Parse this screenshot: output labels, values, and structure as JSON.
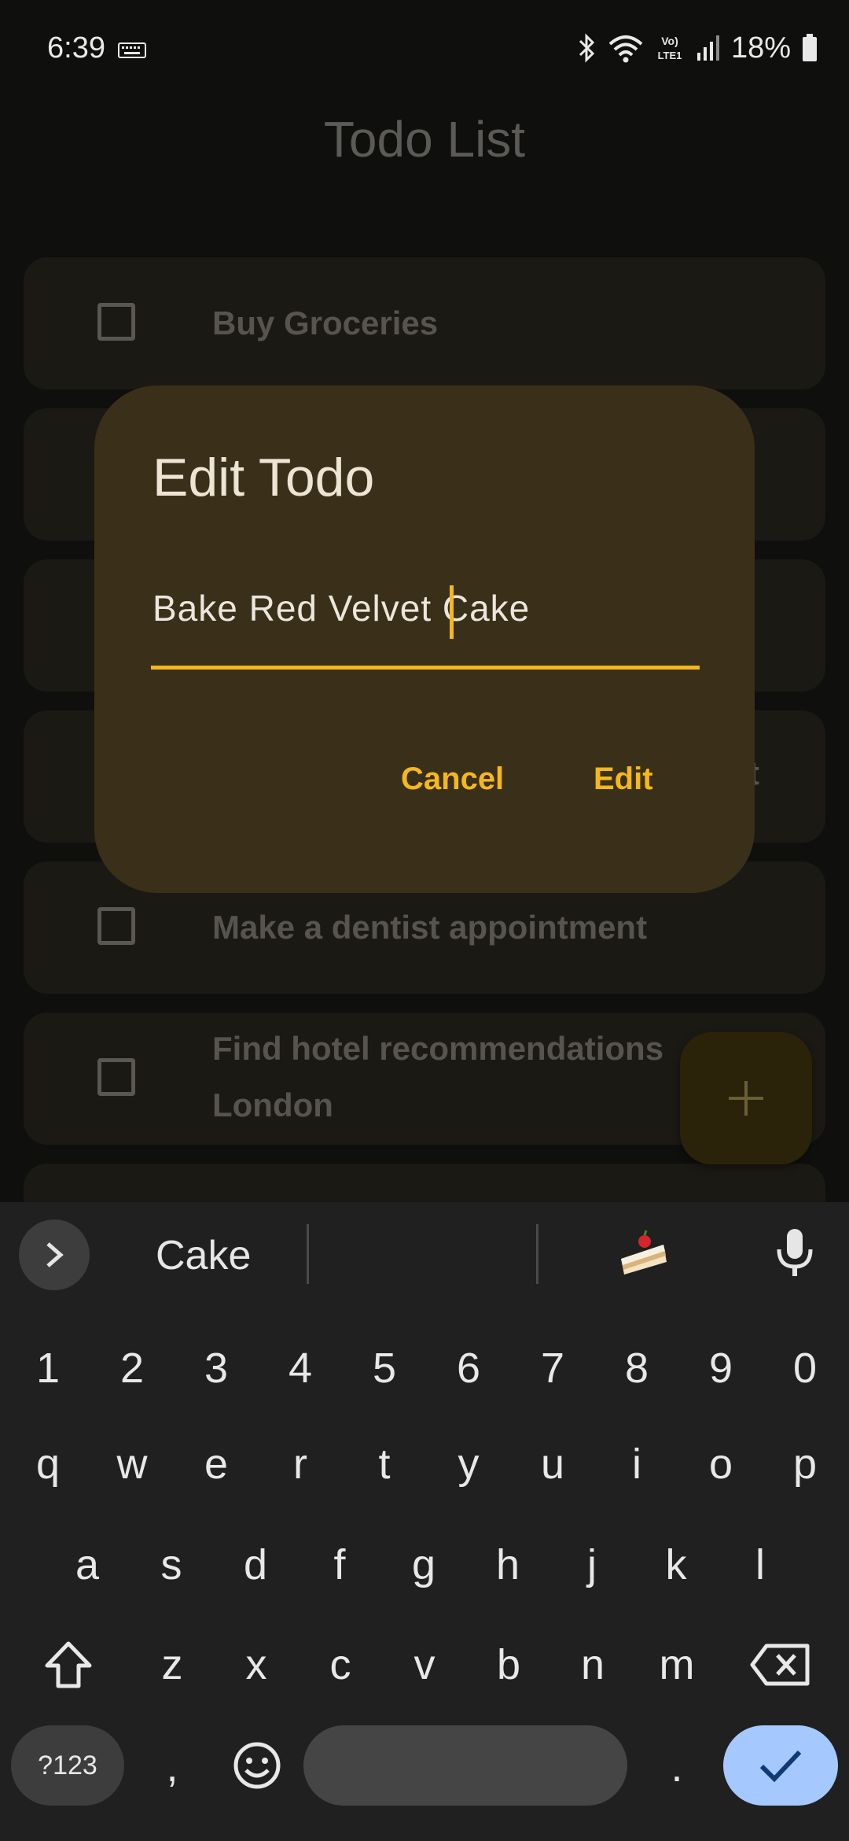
{
  "status_bar": {
    "time": "6:39",
    "battery": "18%",
    "icons": [
      "keyboard-indicator-icon",
      "bluetooth-icon",
      "wifi-icon",
      "volte-icon",
      "signal-icon",
      "battery-icon"
    ]
  },
  "app": {
    "title": "Todo List",
    "todos": [
      {
        "label": "Buy Groceries"
      },
      {
        "label": ""
      },
      {
        "label": ""
      },
      {
        "label": "st"
      },
      {
        "label": "Make a dentist appointment"
      },
      {
        "label": "Find hotel recommendations",
        "label_line2": "London"
      }
    ]
  },
  "dialog": {
    "title": "Edit Todo",
    "field_value": "Bake Red Velvet Cake",
    "cancel_label": "Cancel",
    "confirm_label": "Edit"
  },
  "keyboard": {
    "suggestions": [
      "Cake",
      "",
      ""
    ],
    "number_row": [
      "1",
      "2",
      "3",
      "4",
      "5",
      "6",
      "7",
      "8",
      "9",
      "0"
    ],
    "row1": [
      "q",
      "w",
      "e",
      "r",
      "t",
      "y",
      "u",
      "i",
      "o",
      "p"
    ],
    "row2": [
      "a",
      "s",
      "d",
      "f",
      "g",
      "h",
      "j",
      "k",
      "l"
    ],
    "row3": [
      "z",
      "x",
      "c",
      "v",
      "b",
      "n",
      "m"
    ],
    "symbols_label": "?123",
    "comma": ",",
    "period": "."
  },
  "colors": {
    "accent": "#f5b81c",
    "dialog_bg": "#3a301a",
    "enter_key": "#a5c8ff"
  }
}
